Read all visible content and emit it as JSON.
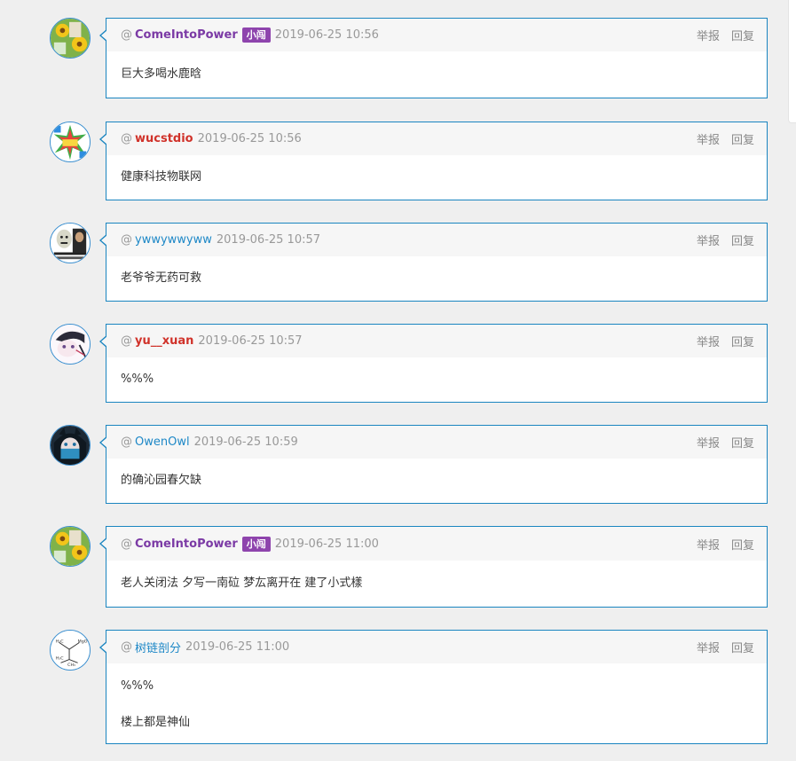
{
  "actions": {
    "report": "举报",
    "reply": "回复"
  },
  "at_symbol": "@",
  "colors": {
    "border": "#1a85c0",
    "link_blue": "#1e88c7",
    "vip_purple": "#7b3aa5",
    "vip_red": "#d0322a",
    "badge_bg": "#8e44ad"
  },
  "comments": [
    {
      "user": "ComeIntoPower",
      "badge": "小闯",
      "time": "2019-06-25 10:56",
      "lines": [
        "巨大多喝水鹿晗"
      ]
    },
    {
      "user": "wucstdio",
      "time": "2019-06-25 10:56",
      "lines": [
        "健康科技物联网"
      ]
    },
    {
      "user": "ywwywwyww",
      "time": "2019-06-25 10:57",
      "lines": [
        "老爷爷无药可救"
      ]
    },
    {
      "user": "yu__xuan",
      "time": "2019-06-25 10:57",
      "lines": [
        "%%%"
      ]
    },
    {
      "user": "OwenOwl",
      "time": "2019-06-25 10:59",
      "lines": [
        "的确沁园春欠缺"
      ]
    },
    {
      "user": "ComeIntoPower",
      "badge": "小闯",
      "time": "2019-06-25 11:00",
      "lines": [
        "老人关闭法 夕写一南砬 梦厷离开在 建了小式樣"
      ]
    },
    {
      "user": "树链剖分",
      "time": "2019-06-25 11:00",
      "lines": [
        "%%%",
        "楼上都是神仙"
      ]
    }
  ]
}
